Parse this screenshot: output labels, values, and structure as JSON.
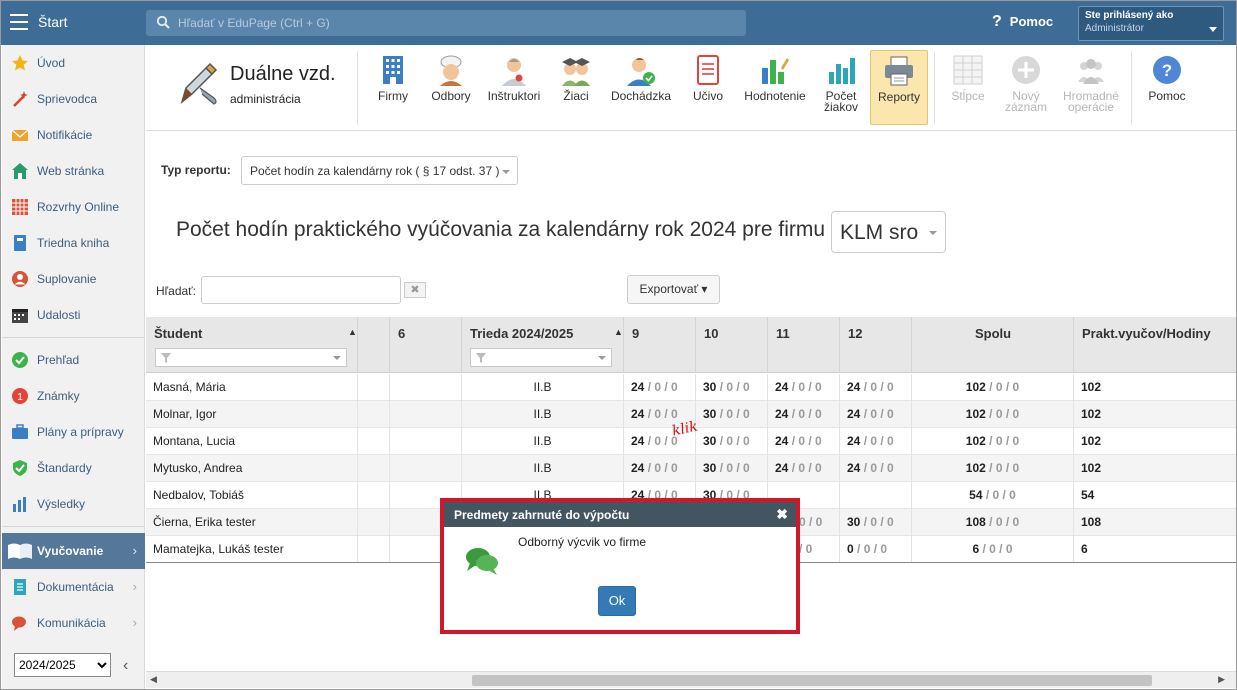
{
  "topbar": {
    "start_label": "Štart",
    "search_placeholder": "Hľadať v EduPage (Ctrl + G)",
    "help_label": "Pomoc",
    "user_line1": "Ste prihlásený ako",
    "user_line2": "Administrátor"
  },
  "sidebar": {
    "items": [
      {
        "label": "Úvod",
        "icon": "star-icon"
      },
      {
        "label": "Sprievodca",
        "icon": "wand-icon"
      },
      {
        "label": "Notifikácie",
        "icon": "envelope-icon"
      },
      {
        "label": "Web stránka",
        "icon": "house-icon"
      },
      {
        "label": "Rozvrhy Online",
        "icon": "grid-icon"
      },
      {
        "label": "Triedna kniha",
        "icon": "book-icon"
      },
      {
        "label": "Suplovanie",
        "icon": "person-icon"
      },
      {
        "label": "Udalosti",
        "icon": "calendar-icon"
      },
      {
        "label": "Prehľad",
        "icon": "check-circle-icon"
      },
      {
        "label": "Známky",
        "icon": "grade-icon"
      },
      {
        "label": "Plány a prípravy",
        "icon": "briefcase-icon"
      },
      {
        "label": "Štandardy",
        "icon": "shield-check-icon"
      },
      {
        "label": "Výsledky",
        "icon": "bar-chart-icon"
      },
      {
        "label": "Vyučovanie",
        "icon": "open-book-icon"
      },
      {
        "label": "Dokumentácia",
        "icon": "document-icon"
      },
      {
        "label": "Komunikácia",
        "icon": "chat-icon"
      }
    ],
    "year": "2024/2025"
  },
  "module": {
    "title": "Duálne vzd.",
    "subtitle": "administrácia"
  },
  "toolbar": {
    "buttons": [
      {
        "label": "Firmy"
      },
      {
        "label": "Odbory"
      },
      {
        "label": "Inštruktori"
      },
      {
        "label": "Žiaci"
      },
      {
        "label": "Dochádzka"
      },
      {
        "label": "Učivo"
      },
      {
        "label": "Hodnotenie"
      },
      {
        "label": "Počet\nžiakov"
      },
      {
        "label": "Reporty"
      },
      {
        "label": "Stĺpce"
      },
      {
        "label": "Nový\nzáznam"
      },
      {
        "label": "Hromadné\noperácie"
      },
      {
        "label": "Pomoc"
      }
    ]
  },
  "report": {
    "type_label": "Typ reportu:",
    "type_value": "Počet hodín za kalendárny rok ( § 17 odst. 37 )",
    "title": "Počet hodín praktického vyúčovania za kalendárny rok 2024 pre firmu",
    "firm": "KLM sro",
    "search_label": "Hľadať:",
    "export_label": "Exportovať ▾",
    "annotation": "klik"
  },
  "grid": {
    "columns": [
      "Študent",
      "6",
      "Trieda 2024/2025",
      "9",
      "10",
      "11",
      "12",
      "Spolu",
      "Prakt.vyučov/Hodiny"
    ],
    "rows": [
      {
        "student": "Masná, Mária",
        "trieda": "II.B",
        "m9": "24",
        "m10": "30",
        "m11": "24",
        "m12": "24",
        "spolu": "102",
        "prakt": "102"
      },
      {
        "student": "Molnar, Igor",
        "trieda": "II.B",
        "m9": "24",
        "m10": "30",
        "m11": "24",
        "m12": "24",
        "spolu": "102",
        "prakt": "102"
      },
      {
        "student": "Montana, Lucia",
        "trieda": "II.B",
        "m9": "24",
        "m10": "30",
        "m11": "24",
        "m12": "24",
        "spolu": "102",
        "prakt": "102"
      },
      {
        "student": "Mytusko, Andrea",
        "trieda": "II.B",
        "m9": "24",
        "m10": "30",
        "m11": "24",
        "m12": "24",
        "spolu": "102",
        "prakt": "102"
      },
      {
        "student": "Nedbalov, Tobiáš",
        "trieda": "II.B",
        "m9": "24",
        "m10": "30",
        "m11": "",
        "m12": "",
        "spolu": "54",
        "prakt": "54"
      },
      {
        "student": "Čierna, Erika tester",
        "trieda": "",
        "m9": "",
        "m10": "",
        "m11": "",
        "m12": "30",
        "spolu": "108",
        "prakt": "108"
      },
      {
        "student": "Mamatejka, Lukáš tester",
        "trieda": "",
        "m9": "",
        "m10": "",
        "m11": "",
        "m12": "0",
        "spolu": "6",
        "prakt": "6"
      }
    ],
    "zero_suffix": " / 0 / 0",
    "partial": {
      "r5_m11": "0 / 0",
      "r6_m11": "/ 0"
    }
  },
  "modal": {
    "title": "Predmety zahrnuté do výpočtu",
    "text": "Odborný výcvik vo firme",
    "ok_label": "Ok"
  },
  "colors": {
    "topbar": "#3d6d96",
    "modal_border": "#d3172b",
    "ok_button": "#337ab7",
    "sidebar_active": "#54779a"
  }
}
